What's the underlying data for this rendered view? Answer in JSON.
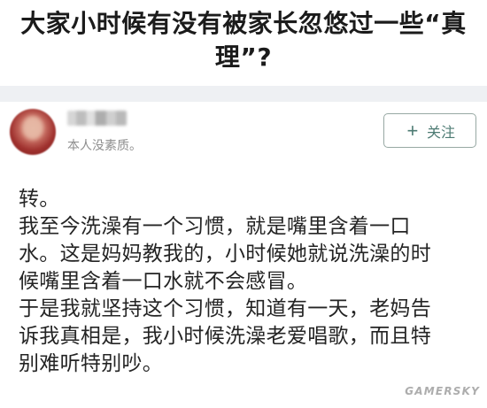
{
  "question": {
    "title_line_1": "大家小时候有没有被家长忽悠过一些“真",
    "title_line_2": "理”?"
  },
  "answer_header": {
    "bio": "本人没素质。",
    "follow_label": "关注",
    "follow_icon": "plus-icon"
  },
  "answer": {
    "lines": [
      "转。",
      "我至今洗澡有一个习惯，就是嘴里含着一口",
      "水。这是妈妈教我的，小时候她就说洗澡的时",
      "候嘴里含着一口水就不会感冒。",
      "于是我就坚持这个习惯，知道有一天，老妈告",
      "诉我真相是，我小时候洗澡老爱唱歌，而且特",
      "别难听特别吵。"
    ]
  },
  "watermark": "GAMERSKY",
  "colors": {
    "title": "#1b1b1b",
    "body_text": "#242424",
    "muted_text": "#8e8e8e",
    "follow_accent": "#4d7b73",
    "divider": "#eef0f3"
  }
}
